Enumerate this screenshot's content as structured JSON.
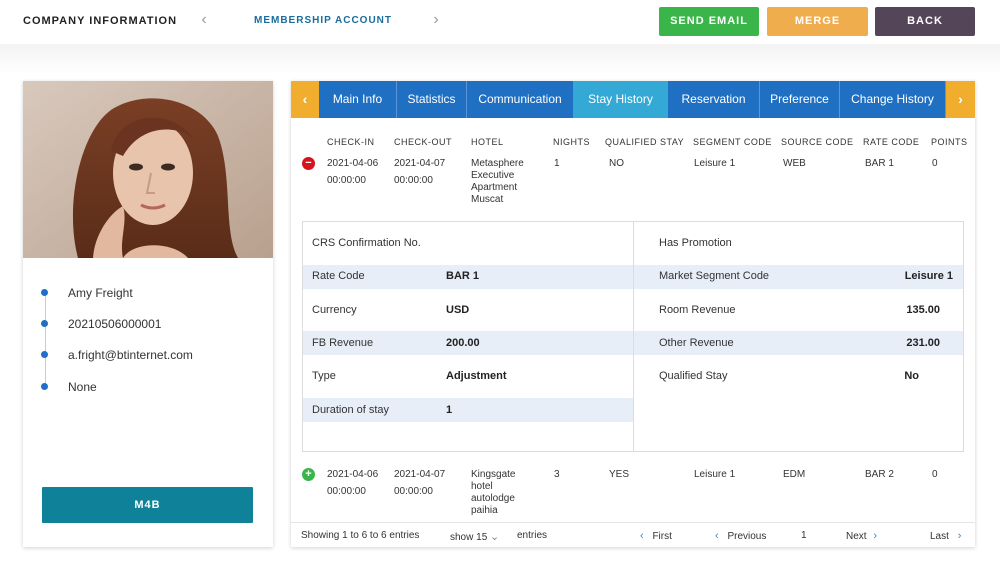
{
  "header": {
    "section": "COMPANY INFORMATION",
    "current": "MEMBERSHIP ACCOUNT",
    "prev_icon": "‹",
    "next_icon": "›",
    "buttons": {
      "send_email": "SEND EMAIL",
      "merge": "MERGE",
      "back": "BACK"
    },
    "colors": {
      "send_email": "#3ab54a",
      "merge": "#f0ad4e",
      "back": "#544559"
    }
  },
  "profile": {
    "name": "Amy Freight",
    "member_id": "20210506000001",
    "email": "a.fright@btinternet.com",
    "extra": "None",
    "button": "M4B"
  },
  "tabs": {
    "left_arrow": "‹",
    "right_arrow": "›",
    "items": [
      "Main Info",
      "Statistics",
      "Communication",
      "Stay History",
      "Reservation",
      "Preference",
      "Change History"
    ],
    "active": "Stay History"
  },
  "table": {
    "columns": [
      "CHECK-IN",
      "CHECK-OUT",
      "HOTEL",
      "NIGHTS",
      "QUALIFIED STAY",
      "SEGMENT CODE",
      "SOURCE CODE",
      "RATE CODE",
      "POINTS"
    ],
    "rows": [
      {
        "toggle": "−",
        "checkin_date": "2021-04-06",
        "checkin_time": "00:00:00",
        "checkout_date": "2021-04-07",
        "checkout_time": "00:00:00",
        "hotel": [
          "Metasphere",
          "Executive",
          "Apartment",
          "Muscat"
        ],
        "nights": "1",
        "qualified": "NO",
        "segment": "Leisure 1",
        "source": "WEB",
        "rate": "BAR 1",
        "points": "0"
      },
      {
        "toggle": "+",
        "checkin_date": "2021-04-06",
        "checkin_time": "00:00:00",
        "checkout_date": "2021-04-07",
        "checkout_time": "00:00:00",
        "hotel": [
          "Kingsgate",
          "hotel",
          "autolodge",
          "paihia"
        ],
        "nights": "3",
        "qualified": "YES",
        "segment": "Leisure 1",
        "source": "EDM",
        "rate": "BAR 2",
        "points": "0"
      }
    ]
  },
  "details": {
    "left": [
      {
        "label": "CRS Confirmation No.",
        "value": ""
      },
      {
        "label": "Rate Code",
        "value": "BAR 1"
      },
      {
        "label": "Currency",
        "value": "USD"
      },
      {
        "label": "FB Revenue",
        "value": "200.00"
      },
      {
        "label": "Type",
        "value": "Adjustment"
      },
      {
        "label": "Duration of stay",
        "value": "1"
      }
    ],
    "right": [
      {
        "label": "Has Promotion",
        "value": ""
      },
      {
        "label": "Market Segment Code",
        "value": "Leisure 1"
      },
      {
        "label": "Room Revenue",
        "value": "135.00"
      },
      {
        "label": "Other Revenue",
        "value": "231.00"
      },
      {
        "label": "Qualified Stay",
        "value": "No"
      }
    ]
  },
  "footer": {
    "showing": "Showing 1 to 6 to 6 entries",
    "show": "show",
    "page_size": "15",
    "entries": "entries",
    "first": "First",
    "previous": "Previous",
    "page": "1",
    "next": "Next",
    "last": "Last"
  }
}
